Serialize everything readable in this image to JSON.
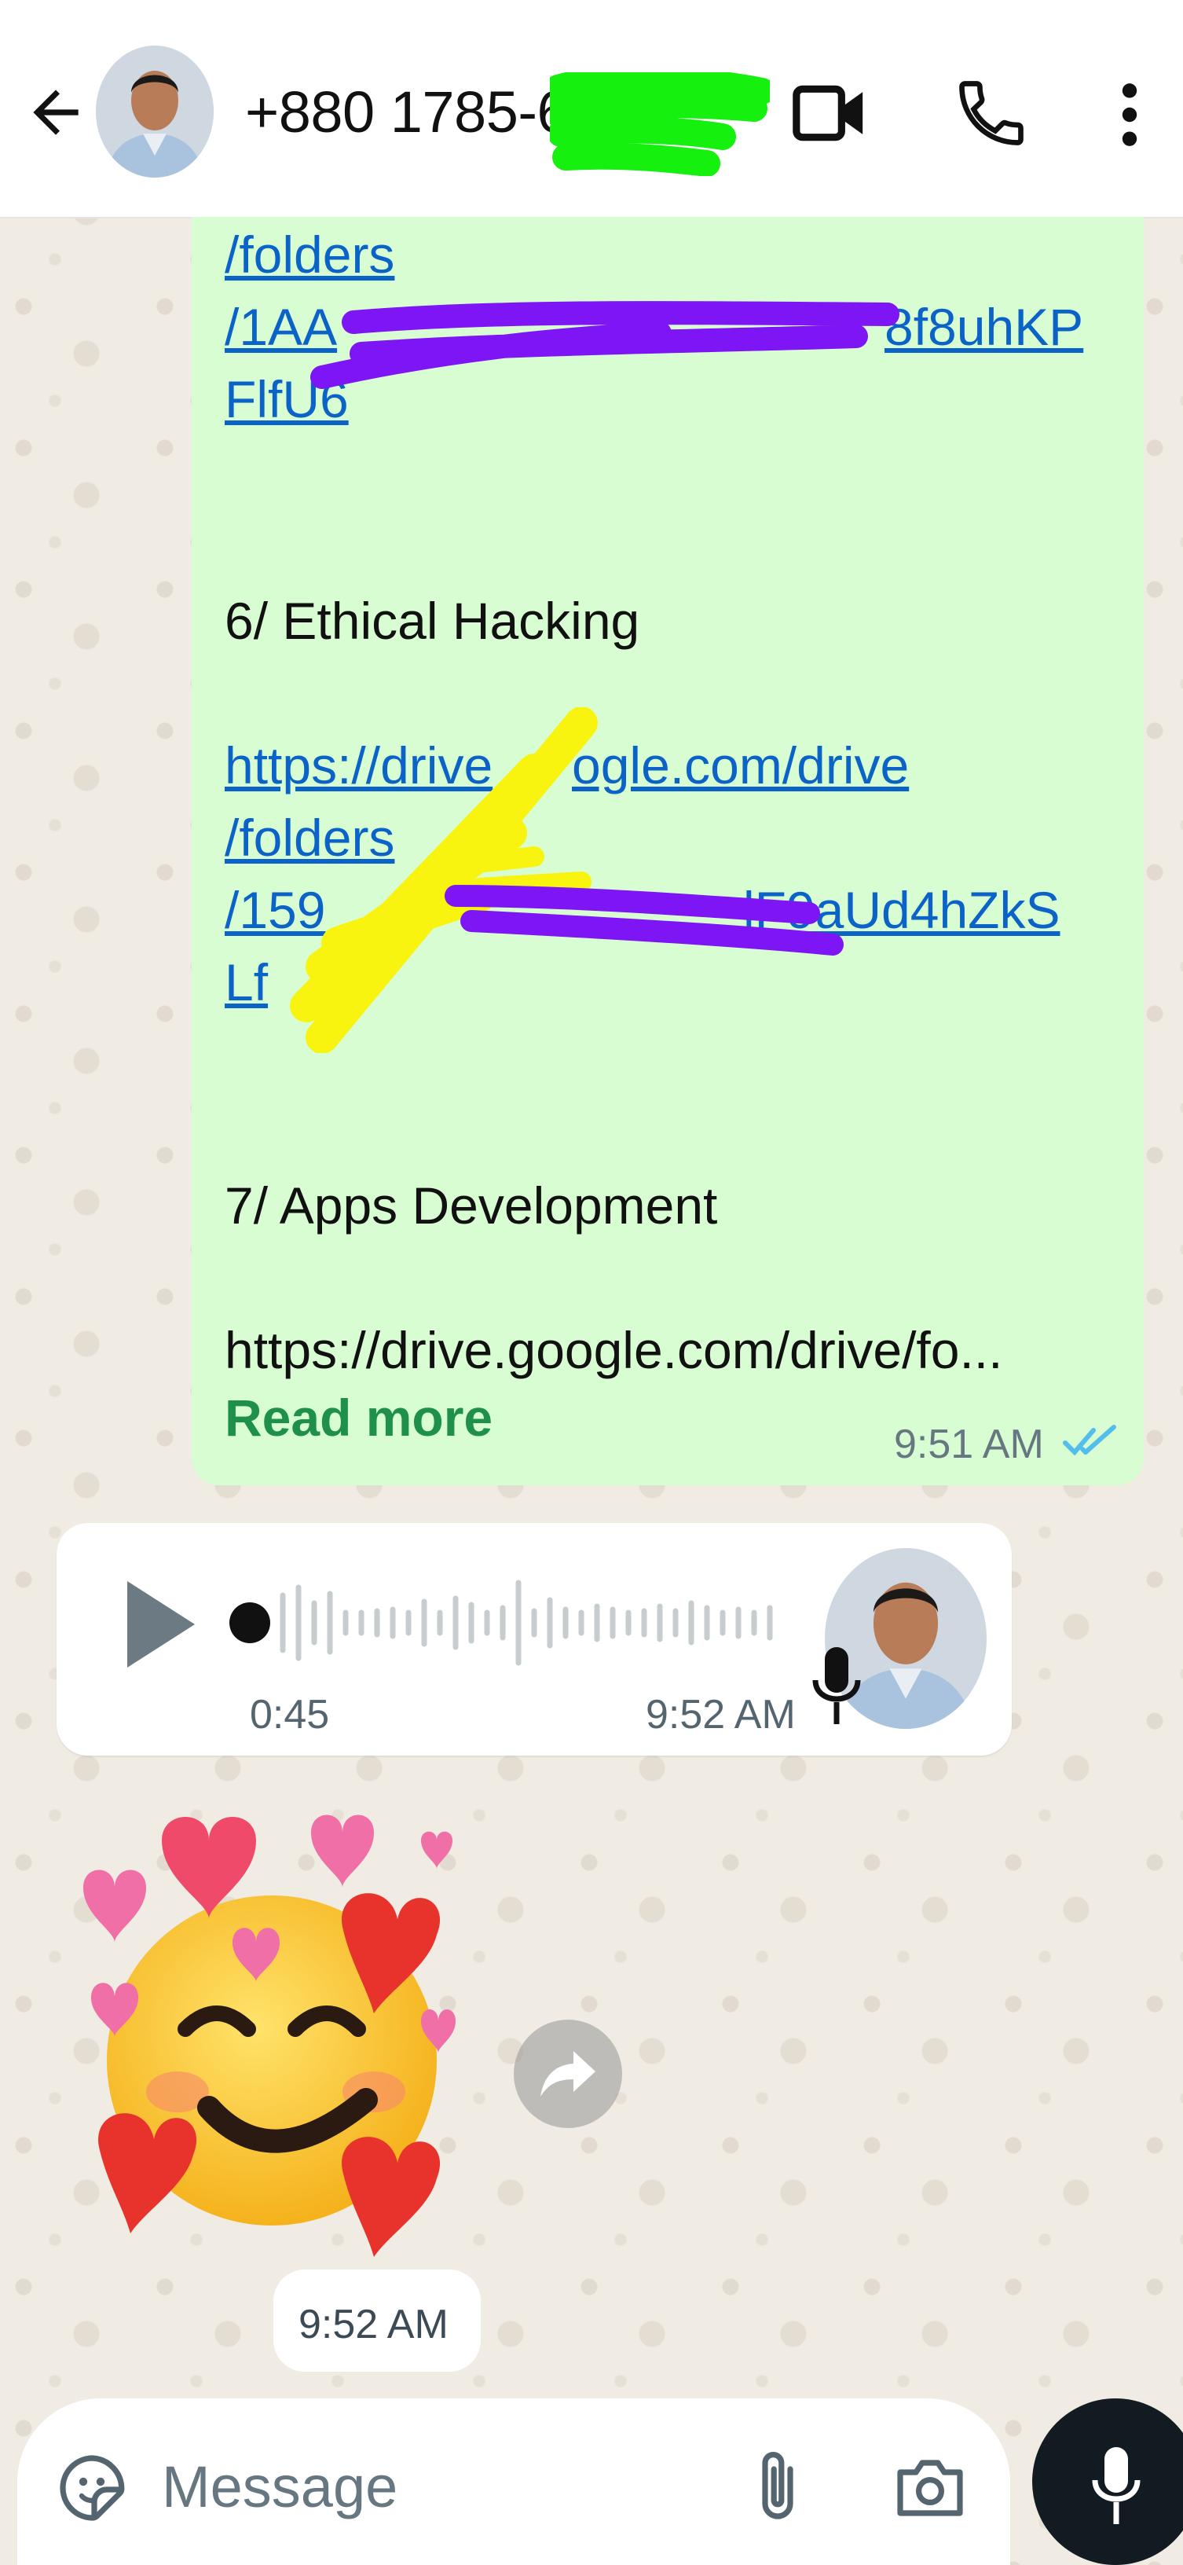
{
  "header": {
    "contact_name": "+880 1785-63",
    "icons": [
      "back-arrow-icon",
      "avatar",
      "video-call-icon",
      "phone-icon",
      "more-vert-icon"
    ]
  },
  "outgoing_message": {
    "lines": [
      {
        "text": "/folders",
        "kind": "link"
      },
      {
        "text": "/1AA",
        "kind": "link",
        "redacted": true
      },
      {
        "text": "8f8uhKP",
        "kind": "link"
      },
      {
        "text": "FlfU6",
        "kind": "link"
      },
      {
        "text": "6/ Ethical Hacking",
        "kind": "text"
      },
      {
        "text": "https://drive",
        "kind": "link",
        "redacted": true
      },
      {
        "text": "ogle.com/drive",
        "kind": "link"
      },
      {
        "text": "/folders",
        "kind": "link"
      },
      {
        "text": "/159",
        "kind": "link",
        "redacted": true
      },
      {
        "text": "lF9aUd4hZkS",
        "kind": "link"
      },
      {
        "text": "Lf",
        "kind": "link",
        "redacted": true
      },
      {
        "text": "7/ Apps Development",
        "kind": "text"
      },
      {
        "text": "https://drive.google.com/drive/fo...",
        "kind": "text"
      }
    ],
    "read_more": "Read more",
    "time": "9:51 AM",
    "status": "read"
  },
  "voice_message": {
    "duration": "0:45",
    "time": "9:52 AM"
  },
  "sticker_message": {
    "time": "9:52 AM"
  },
  "composer": {
    "placeholder": "Message"
  },
  "colors": {
    "bubble_out": "#d8fdd2",
    "link": "#0c63c7",
    "read_more": "#1f8f4e",
    "read_ticks": "#53bdeb"
  }
}
